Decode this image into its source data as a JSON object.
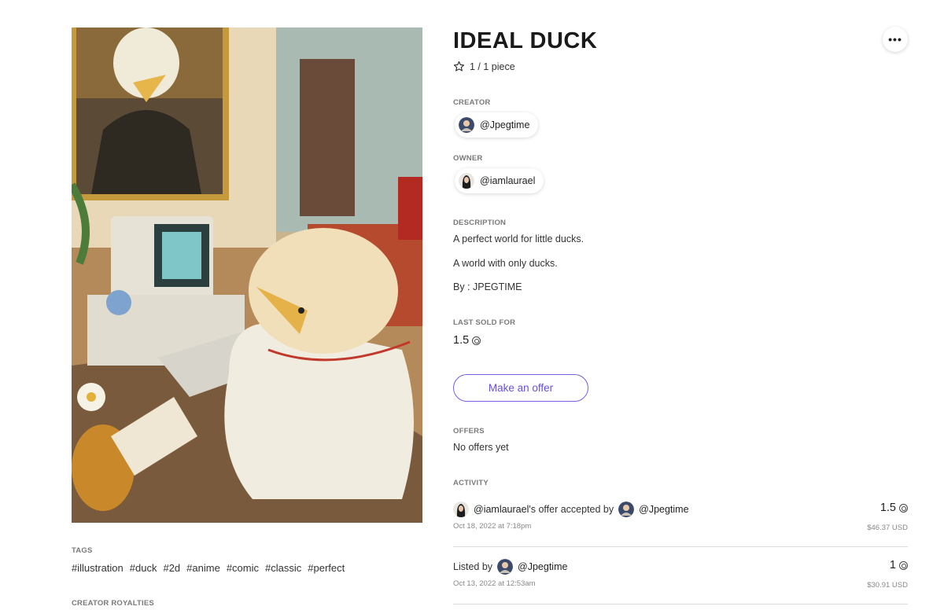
{
  "nft": {
    "title": "IDEAL DUCK",
    "edition": "1 / 1 piece",
    "creator": {
      "label": "CREATOR",
      "handle": "@Jpegtime"
    },
    "owner": {
      "label": "OWNER",
      "handle": "@iamlaurael"
    },
    "description": {
      "label": "DESCRIPTION",
      "lines": [
        "A perfect world for little ducks.",
        "A world with only ducks.",
        "By : JPEGTIME"
      ]
    },
    "last_sold": {
      "label": "LAST SOLD FOR",
      "value": "1.5"
    },
    "offer_button": "Make an offer",
    "offers": {
      "label": "OFFERS",
      "empty_text": "No offers yet"
    },
    "activity": {
      "label": "ACTIVITY",
      "items": [
        {
          "actor": "@iamlaurael",
          "text": "'s offer accepted by",
          "target": "@Jpegtime",
          "time": "Oct 18, 2022 at 7:18pm",
          "amount": "1.5",
          "usd": "$46.37 USD"
        },
        {
          "prefix": "Listed by",
          "actor": "@Jpegtime",
          "time": "Oct 13, 2022 at 12:53am",
          "amount": "1",
          "usd": "$30.91 USD"
        }
      ]
    }
  },
  "tags": {
    "label": "TAGS",
    "items": [
      "#illustration",
      "#duck",
      "#2d",
      "#anime",
      "#comic",
      "#classic",
      "#perfect"
    ]
  },
  "royalties": {
    "label": "CREATOR ROYALTIES"
  },
  "icons": {
    "more": "more-horizontal-icon",
    "edition": "star-icon",
    "currency": "coin-icon"
  },
  "colors": {
    "accent": "#7b5ee0"
  }
}
